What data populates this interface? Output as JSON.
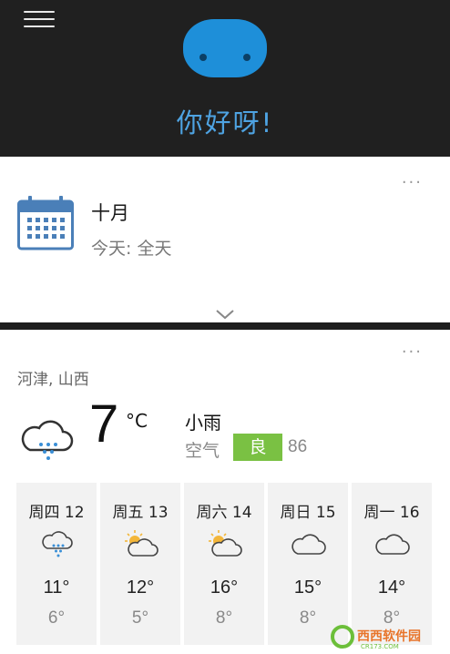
{
  "header": {
    "greeting": "你好呀!",
    "menu_icon": "hamburger-menu-icon",
    "avatar_icon": "cortana-avatar-icon",
    "background": "#202020",
    "accent": "#4ea3e2"
  },
  "calendar": {
    "icon": "calendar-icon",
    "title": "十月",
    "subtitle": "今天: 全天",
    "more_label": "···",
    "expand_icon": "chevron-down-icon"
  },
  "weather": {
    "more_label": "···",
    "location": "河津, 山西",
    "current": {
      "icon": "cloud-rain-icon",
      "temperature": "7",
      "unit": "°C",
      "condition": "小雨",
      "air_label": "空气",
      "air_quality": "良",
      "air_value": "86",
      "air_color": "#7ac143"
    },
    "forecast": [
      {
        "day": "周四 12",
        "icon": "cloud-rain-icon",
        "high": "11°",
        "low": "6°"
      },
      {
        "day": "周五 13",
        "icon": "partly-sunny-icon",
        "high": "12°",
        "low": "5°"
      },
      {
        "day": "周六 14",
        "icon": "partly-sunny-icon",
        "high": "16°",
        "low": "8°"
      },
      {
        "day": "周日 15",
        "icon": "cloud-icon",
        "high": "15°",
        "low": "8°"
      },
      {
        "day": "周一 16",
        "icon": "cloud-icon",
        "high": "14°",
        "low": "8°"
      }
    ]
  },
  "watermark": {
    "text": "西西软件园",
    "subtext": "CR173.COM"
  }
}
